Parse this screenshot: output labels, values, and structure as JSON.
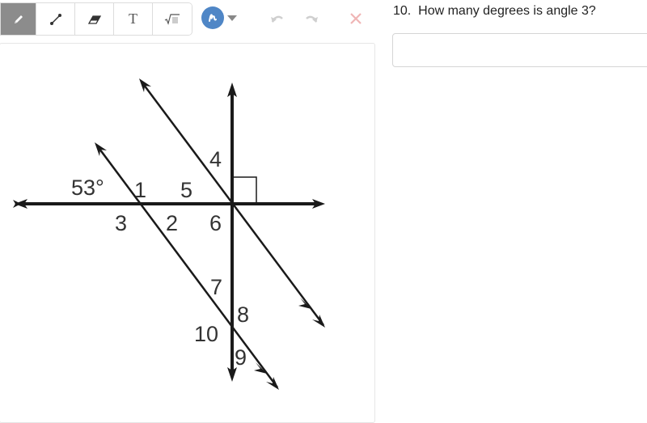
{
  "toolbar": {
    "tools": [
      {
        "name": "pencil",
        "icon": "pencil-icon",
        "active": true
      },
      {
        "name": "line",
        "icon": "line-segment-icon",
        "active": false
      },
      {
        "name": "eraser",
        "icon": "eraser-icon",
        "active": false
      },
      {
        "name": "text",
        "icon": "text-icon",
        "label": "T",
        "active": false
      },
      {
        "name": "math",
        "icon": "square-root-icon",
        "label": "√",
        "active": false
      }
    ],
    "color": "#4f86c6",
    "undo_icon": "undo-icon",
    "redo_icon": "redo-icon",
    "clear_icon": "close-icon"
  },
  "question": {
    "number": "10.",
    "text": "How many degrees is angle 3?",
    "full": "10.  How many degrees is angle 3?"
  },
  "answer": {
    "value": "",
    "placeholder": ""
  },
  "diagram": {
    "given_angle": "53°",
    "angle_labels": [
      "1",
      "2",
      "3",
      "4",
      "5",
      "6",
      "7",
      "8",
      "9",
      "10"
    ]
  }
}
